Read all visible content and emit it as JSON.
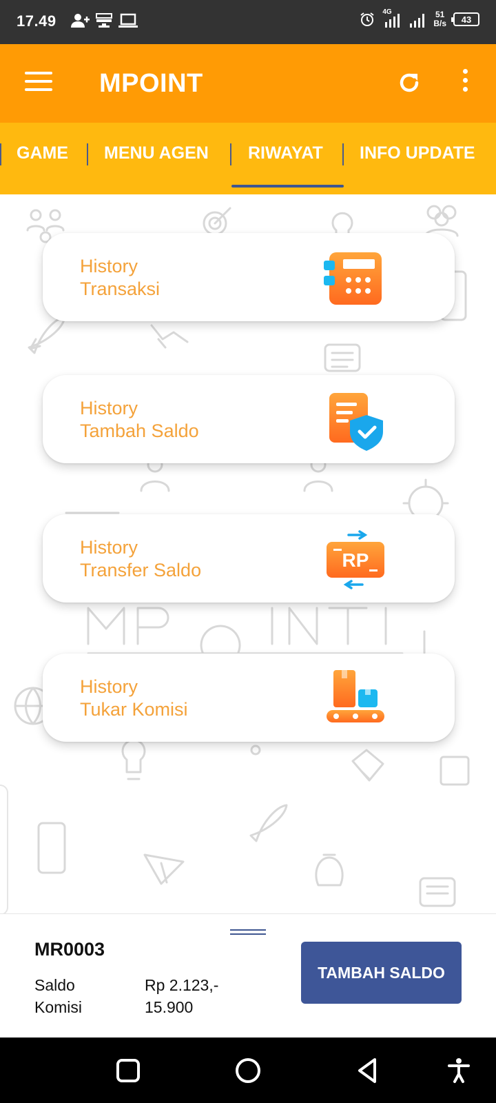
{
  "status_bar": {
    "time": "17.49",
    "network_type": "4G",
    "speed_value": "51",
    "speed_unit": "B/s",
    "battery": "43"
  },
  "app_bar": {
    "title": "MPOINT",
    "background_color": "#ff9b05"
  },
  "tabs": [
    {
      "label": "GAME",
      "active": false
    },
    {
      "label": "MENU AGEN",
      "active": false
    },
    {
      "label": "RIWAYAT",
      "active": true
    },
    {
      "label": "INFO UPDATE",
      "active": false
    }
  ],
  "tab_bar_color": "#ffb90f",
  "menu_cards": [
    {
      "line1": "History",
      "line2": "Transaksi",
      "icon": "calculator-icon"
    },
    {
      "line1": "History",
      "line2": "Tambah Saldo",
      "icon": "document-shield-icon"
    },
    {
      "line1": "History",
      "line2": "Transfer Saldo",
      "icon": "rupiah-transfer-icon"
    },
    {
      "line1": "History",
      "line2": "Tukar Komisi",
      "icon": "conveyor-box-icon"
    }
  ],
  "account": {
    "id": "MR0003",
    "saldo_label": "Saldo",
    "saldo_value": "Rp 2.123,-",
    "komisi_label": "Komisi",
    "komisi_value": "15.900",
    "topup_label": "TAMBAH SALDO",
    "button_color": "#3e5698"
  }
}
